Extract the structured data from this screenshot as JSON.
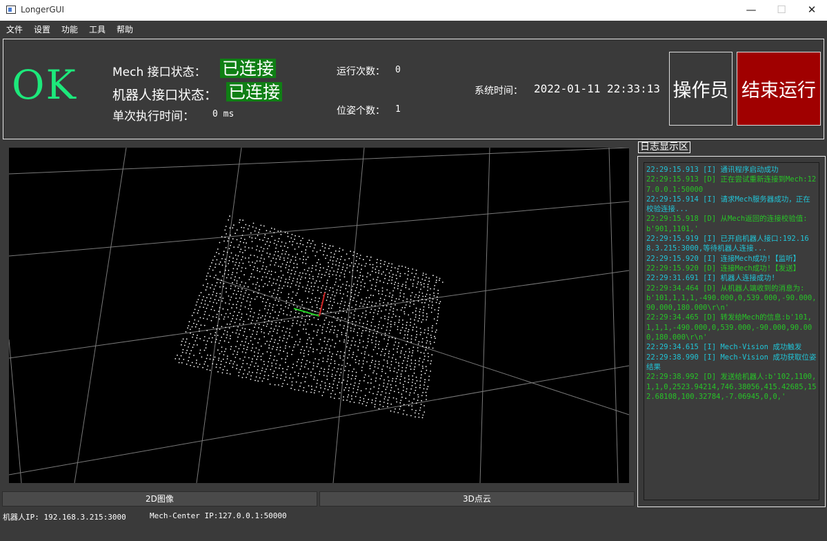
{
  "window": {
    "title": "LongerGUI",
    "min": "—",
    "max": "☐",
    "close": "✕"
  },
  "menu": [
    "文件",
    "设置",
    "功能",
    "工具",
    "帮助"
  ],
  "status": {
    "ok": "OK",
    "mech_label": "Mech 接口状态：",
    "mech_value": "已连接",
    "robot_label": "机器人接口状态：",
    "robot_value": "已连接",
    "exec_label": "单次执行时间：",
    "exec_value": "0 ms",
    "run_count_label": "运行次数：",
    "run_count_value": "0",
    "pose_count_label": "位姿个数：",
    "pose_count_value": "1",
    "sys_time_label": "系统时间：",
    "sys_time_value": "2022-01-11 22:33:13",
    "operator_button": "操作员",
    "stop_button": "结束运行"
  },
  "tabs": {
    "image2d": "2D图像",
    "cloud3d": "3D点云"
  },
  "log": {
    "title": "日志显示区",
    "entries": [
      {
        "text": "22:29:15.913 [I] 通讯程序启动成功",
        "level": "I"
      },
      {
        "text": "22:29:15.913 [D] 正在尝试重新连接到Mech:127.0.0.1:50000",
        "level": "D"
      },
      {
        "text": "22:29:15.914 [I] 请求Mech服务器成功，正在校验连接...",
        "level": "I"
      },
      {
        "text": "22:29:15.918 [D] 从Mech返回的连接校验值:b'901,1101,'",
        "level": "D"
      },
      {
        "text": "22:29:15.919 [I] 已开启机器人接口:192.168.3.215:3000,等待机器人连接...",
        "level": "I"
      },
      {
        "text": "22:29:15.920 [I] 连接Mech成功!【监听】",
        "level": "I"
      },
      {
        "text": "22:29:15.920 [D] 连接Mech成功!【发送】",
        "level": "D"
      },
      {
        "text": "22:29:31.691 [I] 机器人连接成功!",
        "level": "I"
      },
      {
        "text": "22:29:34.464 [D] 从机器人端收到的消息为:b'101,1,1,1,-490.000,0,539.000,-90.000,90.000,180.000\\r\\n'",
        "level": "D"
      },
      {
        "text": "22:29:34.465 [D] 转发给Mech的信息:b'101,1,1,1,-490.000,0,539.000,-90.000,90.000,180.000\\r\\n'",
        "level": "D"
      },
      {
        "text": "22:29:34.615 [I] Mech-Vision 成功触发",
        "level": "I"
      },
      {
        "text": "22:29:38.990 [I] Mech-Vision 成功获取位姿结果",
        "level": "I"
      },
      {
        "text": "22:29:38.992 [D] 发送给机器人:b'102,1100,1,1,0,2523.94214,746.38056,415.42685,152.68108,100.32784,-7.06945,0,0,'",
        "level": "D"
      }
    ],
    "colors": {
      "I": "#21c3d6",
      "D": "#27c427"
    }
  },
  "footer": {
    "robot_ip": "机器人IP: 192.168.3.215:3000",
    "mech_ip": "Mech-Center IP:127.0.0.1:50000"
  },
  "colors": {
    "ok": "#1de87b",
    "connected_bg": "#0f7f14",
    "stop_bg": "#a00000"
  }
}
